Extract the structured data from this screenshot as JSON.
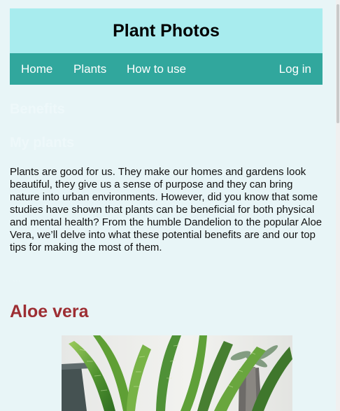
{
  "site": {
    "title": "Plant Photos"
  },
  "nav": {
    "items": [
      {
        "label": "Home"
      },
      {
        "label": "Plants"
      },
      {
        "label": "How to use"
      }
    ],
    "login_label": "Log in"
  },
  "content": {
    "faded_heading_one": "Benefits",
    "faded_heading_two": "My plants",
    "intro_text": "Plants are good for us. They make our homes and gardens look beautiful, they give us a sense of purpose and they can bring nature into urban environments. However, did you know that some studies have shown that plants can be beneficial for both physical and mental health? From the humble Dandelion to the popular Aloe Vera, we’ll delve into what these potential benefits are and our top tips for making the most of them.",
    "faded_mark": "...",
    "section_title": "Aloe vera"
  },
  "colors": {
    "page_background": "#e8f5f7",
    "header_background": "#a8ecee",
    "nav_background": "#31a79d",
    "section_title": "#9d2e33"
  }
}
